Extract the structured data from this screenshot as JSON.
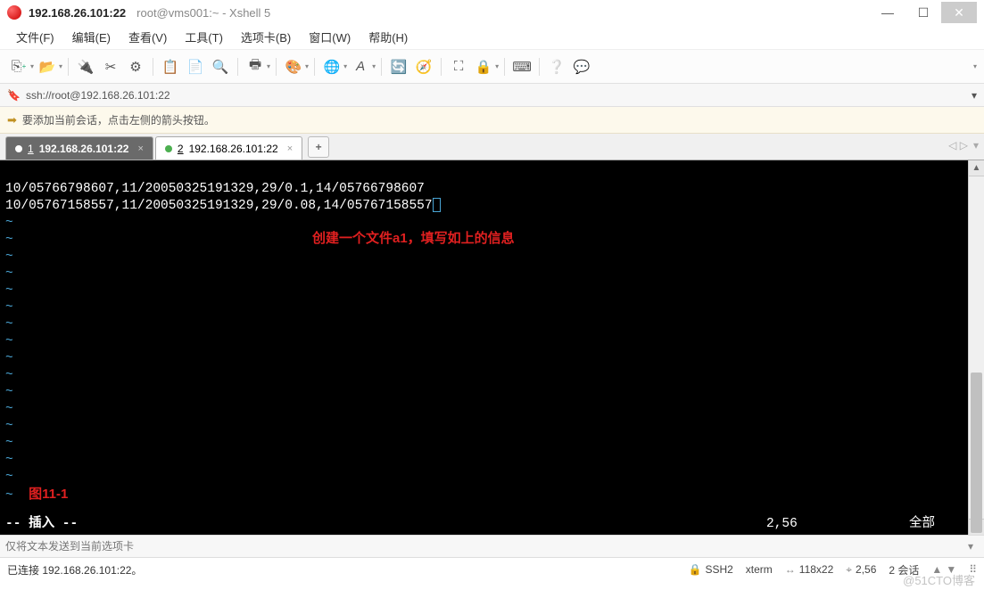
{
  "title": {
    "main": "192.168.26.101:22",
    "sub": "root@vms001:~ - Xshell 5"
  },
  "menu": {
    "file": "文件(F)",
    "edit": "编辑(E)",
    "view": "查看(V)",
    "tools": "工具(T)",
    "tabs": "选项卡(B)",
    "window": "窗口(W)",
    "help": "帮助(H)"
  },
  "address": "ssh://root@192.168.26.101:22",
  "info_hint": "要添加当前会话，点击左侧的箭头按钮。",
  "tabs": {
    "t1": {
      "num": "1",
      "label": "192.168.26.101:22"
    },
    "t2": {
      "num": "2",
      "label": "192.168.26.101:22"
    },
    "add": "+"
  },
  "terminal": {
    "line1": "10/05766798607,11/20050325191329,29/0.1,14/05766798607",
    "line2": "10/05767158557,11/20050325191329,29/0.08,14/05767158557",
    "annotation": "创建一个文件a1，填写如上的信息",
    "fig_label": "图11-1",
    "mode": "-- 插入 --",
    "pos": "2,56",
    "pct": "全部"
  },
  "input_placeholder": "仅将文本发送到当前选项卡",
  "status": {
    "conn": "已连接 192.168.26.101:22。",
    "proto": "SSH2",
    "term": "xterm",
    "size": "118x22",
    "cursor": "2,56",
    "sessions": "2 会话"
  },
  "watermark": "@51CTO博客"
}
